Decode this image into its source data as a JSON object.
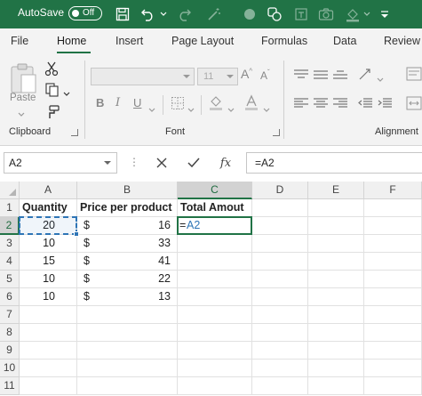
{
  "title_bar": {
    "autosave_label": "AutoSave",
    "autosave_state": "Off",
    "quick_access_icons": [
      "save-icon",
      "undo-icon",
      "undo-dropdown-icon",
      "redo-icon",
      "magic-wand-icon",
      "record-icon",
      "shapes-icon",
      "camera-icon",
      "fill-color-icon",
      "customize-icon"
    ]
  },
  "tabs": [
    "File",
    "Home",
    "Insert",
    "Page Layout",
    "Formulas",
    "Data",
    "Review"
  ],
  "active_tab": "Home",
  "ribbon": {
    "clipboard_label": "Clipboard",
    "paste_label": "Paste",
    "font_label": "Font",
    "font_size": "11",
    "alignment_label": "Alignment",
    "bold_label": "B",
    "italic_label": "I",
    "underline_label": "U"
  },
  "formula_bar": {
    "name_box": "A2",
    "cancel_glyph": "✕",
    "enter_glyph": "✓",
    "fx_label": "fx",
    "formula": "=A2"
  },
  "grid": {
    "columns": [
      "A",
      "B",
      "C",
      "D",
      "E",
      "F"
    ],
    "rows": [
      "1",
      "2",
      "3",
      "4",
      "5",
      "6",
      "7",
      "8",
      "9",
      "10",
      "11"
    ],
    "headers": [
      "Quantity",
      "Price per product",
      "Total Amout"
    ],
    "currency_symbol": "$",
    "data": [
      {
        "quantity": "20",
        "price": "16"
      },
      {
        "quantity": "10",
        "price": "33"
      },
      {
        "quantity": "15",
        "price": "41"
      },
      {
        "quantity": "10",
        "price": "22"
      },
      {
        "quantity": "10",
        "price": "13"
      }
    ],
    "editing_cell": "C2",
    "editing_value": "=A2",
    "copy_source_cell": "A2"
  },
  "colors": {
    "brand": "#217346",
    "formula_ref": "#2e75b6",
    "selection": "#217346"
  }
}
